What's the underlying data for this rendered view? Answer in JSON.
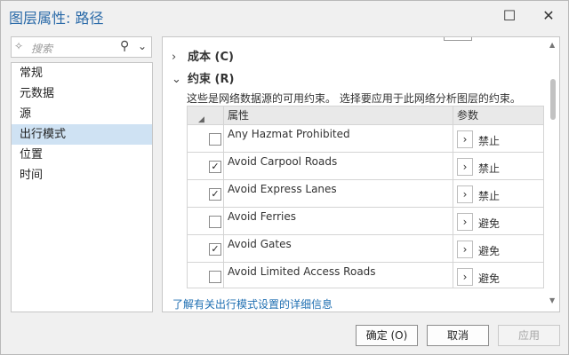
{
  "window": {
    "title": "图层属性: 路径",
    "minimize_icon": "minimize-icon",
    "close_icon": "close-icon",
    "minimize_glyph": "☐",
    "close_glyph": "✕"
  },
  "search": {
    "placeholder": "搜索",
    "left_glyph": "✧",
    "search_glyph": "⚲",
    "dropdown_glyph": "⌄"
  },
  "sidebar": {
    "items": [
      {
        "label": "常规",
        "active": false
      },
      {
        "label": "元数据",
        "active": false
      },
      {
        "label": "源",
        "active": false
      },
      {
        "label": "出行模式",
        "active": true
      },
      {
        "label": "位置",
        "active": false
      },
      {
        "label": "时间",
        "active": false
      }
    ]
  },
  "main": {
    "cost_section": {
      "chevron": "›",
      "label": "成本 (C)",
      "expanded": false
    },
    "restriction_section": {
      "chevron": "⌄",
      "label": "约束 (R)",
      "expanded": true
    },
    "description": "这些是网络数据源的可用约束。 选择要应用于此网络分析图层的约束。",
    "table": {
      "sort_glyph": "◢",
      "col_property": "属性",
      "col_param": "参数",
      "rows": [
        {
          "name": "Any Hazmat Prohibited",
          "checked": false,
          "param": "禁止"
        },
        {
          "name": "Avoid Carpool Roads",
          "checked": true,
          "param": "禁止"
        },
        {
          "name": "Avoid Express Lanes",
          "checked": true,
          "param": "禁止"
        },
        {
          "name": "Avoid Ferries",
          "checked": false,
          "param": "避免"
        },
        {
          "name": "Avoid Gates",
          "checked": true,
          "param": "避免"
        },
        {
          "name": "Avoid Limited Access Roads",
          "checked": false,
          "param": "避免"
        }
      ],
      "expand_glyph": "›",
      "check_glyph": "✓"
    },
    "scroll": {
      "up_glyph": "▲",
      "down_glyph": "▼"
    },
    "learn_more": "了解有关出行模式设置的详细信息"
  },
  "footer": {
    "ok_label": "确定 (O)",
    "cancel_label": "取消",
    "apply_label": "应用",
    "apply_enabled": false
  },
  "colors": {
    "title": "#2a6aa8",
    "active_nav": "#cfe2f3",
    "link": "#1f6fb2"
  }
}
